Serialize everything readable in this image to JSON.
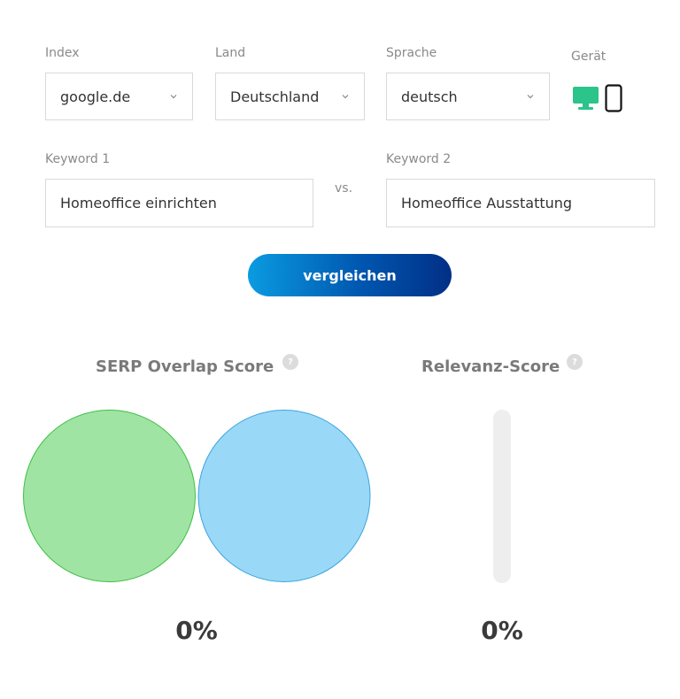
{
  "form": {
    "index": {
      "label": "Index",
      "value": "google.de"
    },
    "country": {
      "label": "Land",
      "value": "Deutschland"
    },
    "language": {
      "label": "Sprache",
      "value": "deutsch"
    },
    "device": {
      "label": "Gerät",
      "selected": "desktop",
      "icons": [
        "desktop-icon",
        "mobile-icon"
      ]
    },
    "keyword1": {
      "label": "Keyword 1",
      "value": "Homeoffice einrichten"
    },
    "vs_label": "vs.",
    "keyword2": {
      "label": "Keyword 2",
      "value": "Homeoffice Ausstattung"
    },
    "compare_label": "vergleichen"
  },
  "scores": {
    "overlap": {
      "title": "SERP Overlap Score",
      "help": "?",
      "value": "0%",
      "fraction": 0
    },
    "relevance": {
      "title": "Relevanz-Score",
      "help": "?",
      "value": "0%",
      "fraction": 0
    }
  },
  "colors": {
    "accent_green": "#2bc48a",
    "circle1_fill": "#a0e4a3",
    "circle1_stroke": "#3cbf45",
    "circle2_fill": "#9ad8f7",
    "circle2_stroke": "#3aa6de",
    "button_start": "#0a9be0",
    "button_end": "#022f86"
  }
}
